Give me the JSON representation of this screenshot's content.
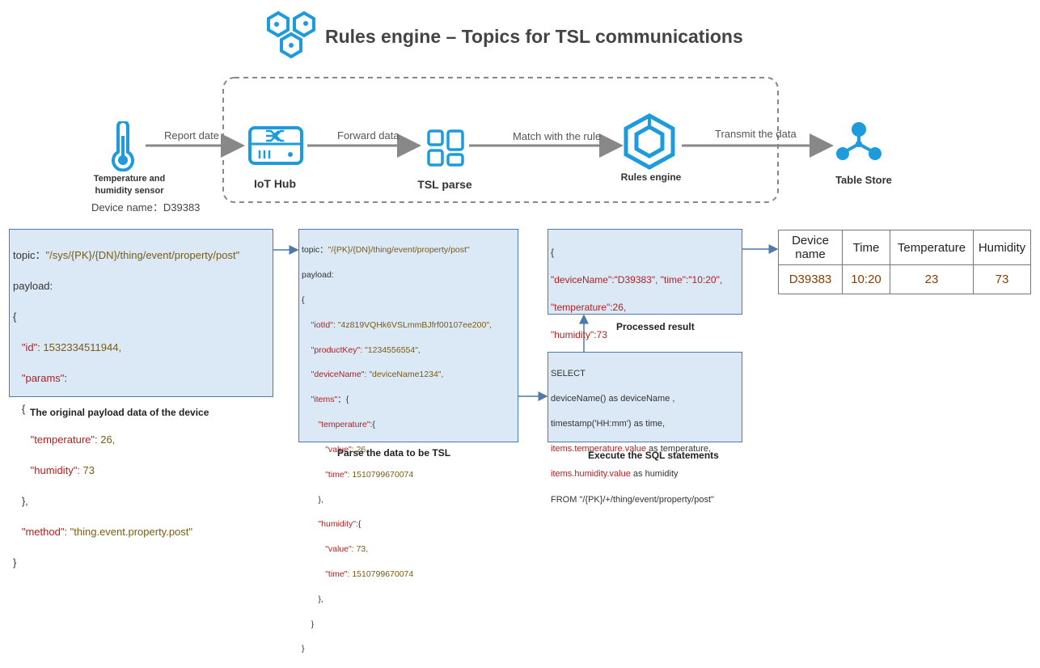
{
  "title": "Rules engine – Topics for TSL communications",
  "flow": {
    "arrows": [
      "Report date",
      "Forward data",
      "Match with the rule",
      "Transmit the data"
    ],
    "sensor": {
      "label_line1": "Temperature and",
      "label_line2": "humidity sensor",
      "device": "Device name：D39383"
    },
    "nodes": {
      "iot_hub": "IoT Hub",
      "tsl_parse": "TSL parse",
      "rules_engine": "Rules engine",
      "table_store": "Table Store"
    }
  },
  "payload_box": {
    "topic_key": "topic：",
    "topic_val": "\"/sys/{PK}/{DN}/thing/event/property/post\"",
    "l_payload": "payload:",
    "l_open": "{",
    "id_k": "\"id\"",
    "id_v": ": 1532334511944,",
    "params_k": "\"params\"",
    "params_c": ":",
    "l_open2": "{",
    "temp_k": "\"temperature\"",
    "temp_v": ": 26,",
    "hum_k": "\"humidity\"",
    "hum_v": ": 73",
    "l_close2": "},",
    "method_k": "\"method\"",
    "method_v": ": \"thing.event.property.post\"",
    "l_close": "}",
    "caption": "The original payload data of the device"
  },
  "tsl_box": {
    "topic_key": "topic：",
    "topic_val": "\"/{PK}/{DN}/thing/event/property/post\"",
    "l_payload": "payload:",
    "l_open": "{",
    "iot_k": "\"iotId\"",
    "iot_v": ": \"4z819VQHk6VSLmmBJfrf00107ee200\",",
    "pk_k": "\"productKey\"",
    "pk_v": ": \"1234556554\",",
    "dn_k": "\"deviceName\"",
    "dn_v": ": \"deviceName1234\",",
    "items_k": "\"items\"",
    "items_v": "：{",
    "temp_k": "\"temperature\"",
    "temp_v": ":{",
    "tv_k": "\"value\"",
    "tv_v": ": 26,",
    "tt_k": "\"time\"",
    "tt_v": ": 1510799670074",
    "close_a": "},",
    "hum_k": "\"humidity\"",
    "hum_v": ":{",
    "hv_k": "\"value\"",
    "hv_v": ": 73,",
    "ht_k": "\"time\"",
    "ht_v": ": 1510799670074",
    "close_b": "},",
    "close_c": "}",
    "close_d": "}",
    "caption": "Parse the data to be TSL"
  },
  "result_box": {
    "l_open": "{",
    "l1": "\"deviceName\":\"D39383\", \"time\":\"10:20\",",
    "l2": "\"temperature\":26,",
    "l3": "\"humidity\":73",
    "l_close": "}",
    "caption": "Processed result"
  },
  "sql_box": {
    "l1": "SELECT",
    "l2": "deviceName() as deviceName ,",
    "l3": "timestamp('HH:mm') as time,",
    "l4_k": "items.temperature.value",
    "l4_v": " as temperature,",
    "l5_k": "items.humidity.value",
    "l5_v": " as humidity",
    "l6": "FROM \"/{PK}/+/thing/event/property/post\"",
    "caption": "Execute the SQL statements"
  },
  "table": {
    "headers": [
      "Device name",
      "Time",
      "Temperature",
      "Humidity"
    ],
    "row": [
      "D39383",
      "10:20",
      "23",
      "73"
    ]
  }
}
